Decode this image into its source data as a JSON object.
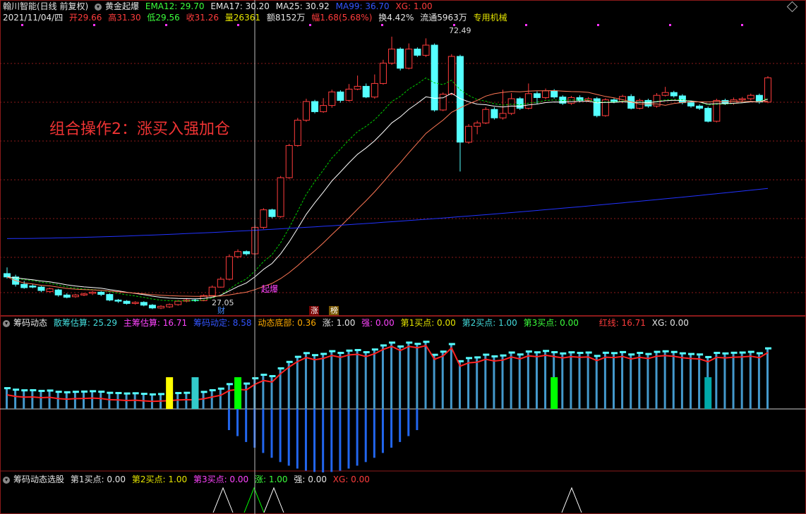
{
  "header": {
    "symbol": "翰川智能(日线 前复权)",
    "indicator": "黄金起爆",
    "ema12": "EMA12: 29.70",
    "ema17": "EMA17: 30.20",
    "ma25": "MA25: 30.92",
    "ma99": "MA99: 36.70",
    "xg": "XG: 1.00",
    "date": "2021/11/04/四",
    "open": "开29.66",
    "high": "高31.30",
    "low": "低29.56",
    "close": "收31.26",
    "vol": "量26361",
    "amount": "额8152万",
    "amp": "幅1.68(5.68%)",
    "turnover": "换4.42%",
    "float": "流通5963万",
    "sector": "专用机械"
  },
  "annotations": {
    "strategy": "组合操作2：涨买入强加仓",
    "high_label": "72.49",
    "low_label": "27.05",
    "qibao": "起爆",
    "cai": "财",
    "zhang": "涨",
    "bang": "榜"
  },
  "indicator2": {
    "name": "筹码动态",
    "sanchou": "散筹估算: 25.29",
    "zhuchou": "主筹估算: 16.71",
    "wending": "筹码动定: 8.58",
    "dibu": "动态底部: 0.36",
    "zhang": "涨: 1.00",
    "qiang": "强: 0.00",
    "buy1": "第1买点: 0.00",
    "buy2": "第2买点: 1.00",
    "buy3": "第3买点: 0.00",
    "hongxian": "红线: 16.71",
    "xg": "XG: 0.00"
  },
  "indicator3": {
    "name": "筹码动态选股",
    "buy1": "第1买点: 0.00",
    "buy2": "第2买点: 1.00",
    "buy3": "第3买点: 0.00",
    "zhang": "涨: 1.00",
    "qiang": "强: 0.00",
    "xg": "XG: 0.00"
  },
  "colors": {
    "up": "#ff3c3c",
    "down": "#55ffff",
    "ema12": "#00cc00",
    "ema17": "#ffffff",
    "ma25": "#ff7755",
    "ma99": "#2233ff",
    "grid": "#8b1a1a"
  },
  "chart_data": {
    "type": "candlestick",
    "y_range": [
      24,
      74
    ],
    "candles": [
      [
        30.5,
        29.9,
        31.6,
        29.6
      ],
      [
        29.9,
        28.6,
        30.3,
        28.2
      ],
      [
        28.6,
        28.0,
        29.2,
        27.8
      ],
      [
        28.3,
        28.1,
        28.6,
        27.9
      ],
      [
        28.1,
        27.5,
        28.3,
        27.2
      ],
      [
        27.3,
        27.8,
        28.0,
        27.1
      ],
      [
        27.6,
        26.7,
        27.8,
        26.4
      ],
      [
        26.7,
        26.3,
        27.0,
        26.1
      ],
      [
        26.4,
        26.7,
        26.9,
        26.2
      ],
      [
        26.7,
        26.9,
        27.1,
        26.5
      ],
      [
        27.0,
        27.2,
        27.4,
        26.7
      ],
      [
        27.2,
        26.8,
        27.4,
        26.5
      ],
      [
        26.8,
        25.8,
        27.0,
        25.6
      ],
      [
        25.8,
        25.6,
        26.0,
        25.3
      ],
      [
        25.6,
        25.2,
        25.8,
        25.0
      ],
      [
        25.2,
        25.4,
        25.6,
        25.0
      ],
      [
        25.4,
        24.9,
        25.6,
        24.7
      ],
      [
        24.9,
        24.4,
        25.1,
        24.2
      ],
      [
        24.4,
        24.7,
        24.9,
        24.2
      ],
      [
        24.6,
        25.0,
        25.2,
        24.4
      ],
      [
        25.0,
        25.6,
        25.8,
        24.8
      ],
      [
        25.6,
        25.8,
        26.0,
        25.4
      ],
      [
        25.8,
        25.7,
        26.0,
        25.5
      ],
      [
        25.7,
        26.6,
        26.8,
        25.6
      ],
      [
        26.6,
        28.1,
        28.4,
        26.5
      ],
      [
        28.1,
        29.5,
        29.9,
        28.0
      ],
      [
        29.5,
        33.5,
        33.9,
        29.3
      ],
      [
        33.5,
        34.4,
        34.8,
        33.2
      ],
      [
        34.4,
        34.0,
        34.6,
        33.7
      ],
      [
        34.0,
        38.7,
        39.1,
        33.8
      ],
      [
        38.7,
        41.8,
        42.1,
        38.4
      ],
      [
        41.8,
        40.6,
        42.0,
        40.3
      ],
      [
        40.6,
        47.5,
        47.8,
        40.4
      ],
      [
        47.5,
        53.2,
        53.5,
        47.3
      ],
      [
        53.2,
        57.7,
        58.1,
        53.0
      ],
      [
        57.7,
        61.0,
        61.5,
        57.4
      ],
      [
        61.0,
        59.2,
        61.3,
        58.9
      ],
      [
        59.2,
        60.3,
        61.6,
        59.0
      ],
      [
        60.3,
        62.7,
        63.1,
        59.9
      ],
      [
        62.7,
        61.2,
        63.0,
        60.8
      ],
      [
        61.2,
        63.2,
        64.1,
        61.0
      ],
      [
        63.2,
        63.7,
        65.6,
        63.0
      ],
      [
        63.7,
        61.8,
        64.2,
        61.6
      ],
      [
        61.8,
        64.2,
        65.8,
        61.5
      ],
      [
        64.2,
        67.8,
        68.4,
        64.0
      ],
      [
        67.8,
        70.3,
        72.5,
        67.5
      ],
      [
        70.3,
        66.9,
        70.6,
        66.5
      ],
      [
        66.9,
        70.3,
        71.3,
        66.7
      ],
      [
        70.3,
        69.2,
        70.6,
        68.9
      ],
      [
        69.2,
        71.0,
        72.2,
        68.9
      ],
      [
        71.0,
        59.5,
        71.3,
        59.2
      ],
      [
        59.5,
        62.3,
        62.6,
        59.3
      ],
      [
        62.3,
        69.0,
        69.4,
        62.1
      ],
      [
        69.0,
        53.8,
        69.3,
        48.6
      ],
      [
        53.8,
        56.6,
        57.0,
        53.5
      ],
      [
        56.6,
        57.2,
        57.6,
        55.2
      ],
      [
        57.2,
        59.6,
        60.0,
        57.0
      ],
      [
        59.6,
        58.1,
        60.0,
        57.8
      ],
      [
        58.1,
        58.9,
        63.1,
        57.8
      ],
      [
        58.9,
        61.5,
        62.5,
        58.6
      ],
      [
        61.5,
        59.8,
        61.8,
        59.5
      ],
      [
        59.8,
        62.4,
        64.2,
        59.6
      ],
      [
        62.4,
        61.7,
        62.8,
        60.6
      ],
      [
        61.7,
        62.9,
        63.3,
        61.4
      ],
      [
        62.9,
        61.8,
        63.2,
        61.5
      ],
      [
        61.8,
        60.7,
        62.1,
        60.4
      ],
      [
        60.7,
        61.7,
        62.0,
        60.4
      ],
      [
        61.7,
        61.2,
        62.1,
        60.9
      ],
      [
        61.2,
        61.5,
        61.8,
        60.9
      ],
      [
        61.5,
        58.5,
        61.8,
        58.2
      ],
      [
        58.5,
        61.3,
        61.6,
        58.3
      ],
      [
        61.3,
        61.0,
        61.6,
        60.7
      ],
      [
        61.0,
        61.9,
        62.2,
        60.7
      ],
      [
        61.9,
        59.8,
        62.3,
        59.6
      ],
      [
        59.8,
        61.2,
        61.5,
        59.6
      ],
      [
        61.2,
        60.2,
        61.5,
        59.9
      ],
      [
        60.2,
        62.1,
        62.5,
        59.9
      ],
      [
        62.1,
        62.6,
        63.6,
        61.9
      ],
      [
        62.6,
        62.0,
        62.9,
        61.7
      ],
      [
        62.0,
        60.8,
        62.3,
        60.5
      ],
      [
        60.8,
        60.2,
        61.2,
        59.9
      ],
      [
        60.2,
        59.8,
        60.5,
        59.5
      ],
      [
        59.8,
        57.5,
        60.1,
        57.3
      ],
      [
        57.5,
        61.2,
        61.5,
        57.3
      ],
      [
        61.2,
        60.7,
        61.5,
        60.4
      ],
      [
        60.7,
        61.3,
        61.7,
        60.4
      ],
      [
        61.3,
        61.5,
        61.8,
        61.0
      ],
      [
        61.5,
        62.1,
        62.4,
        61.2
      ],
      [
        62.1,
        60.9,
        62.4,
        60.6
      ],
      [
        60.9,
        65.2,
        65.5,
        60.7
      ]
    ],
    "ma99_start": 36.7,
    "ma99_end": 45.6
  }
}
